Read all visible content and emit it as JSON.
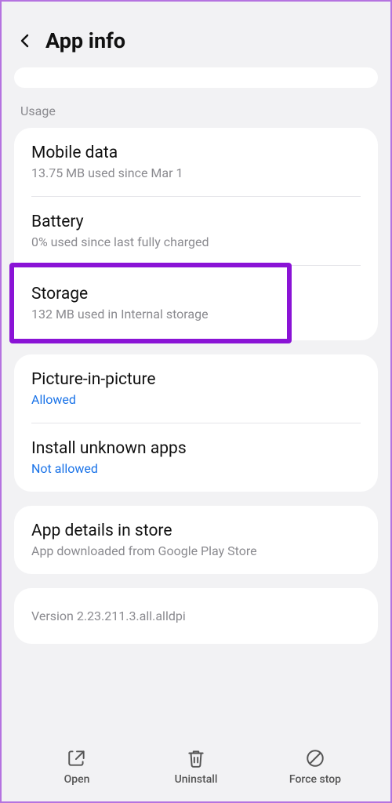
{
  "header": {
    "title": "App info"
  },
  "section_usage_label": "Usage",
  "usage": {
    "mobile_data": {
      "title": "Mobile data",
      "sub": "13.75 MB used since Mar 1"
    },
    "battery": {
      "title": "Battery",
      "sub": "0% used since last fully charged"
    },
    "storage": {
      "title": "Storage",
      "sub": "132 MB used in Internal storage"
    }
  },
  "permissions": {
    "pip": {
      "title": "Picture-in-picture",
      "sub": "Allowed"
    },
    "unknown": {
      "title": "Install unknown apps",
      "sub": "Not allowed"
    }
  },
  "store": {
    "title": "App details in store",
    "sub": "App downloaded from Google Play Store"
  },
  "version": "Version 2.23.211.3.all.alldpi",
  "bottom": {
    "open": "Open",
    "uninstall": "Uninstall",
    "force_stop": "Force stop"
  }
}
